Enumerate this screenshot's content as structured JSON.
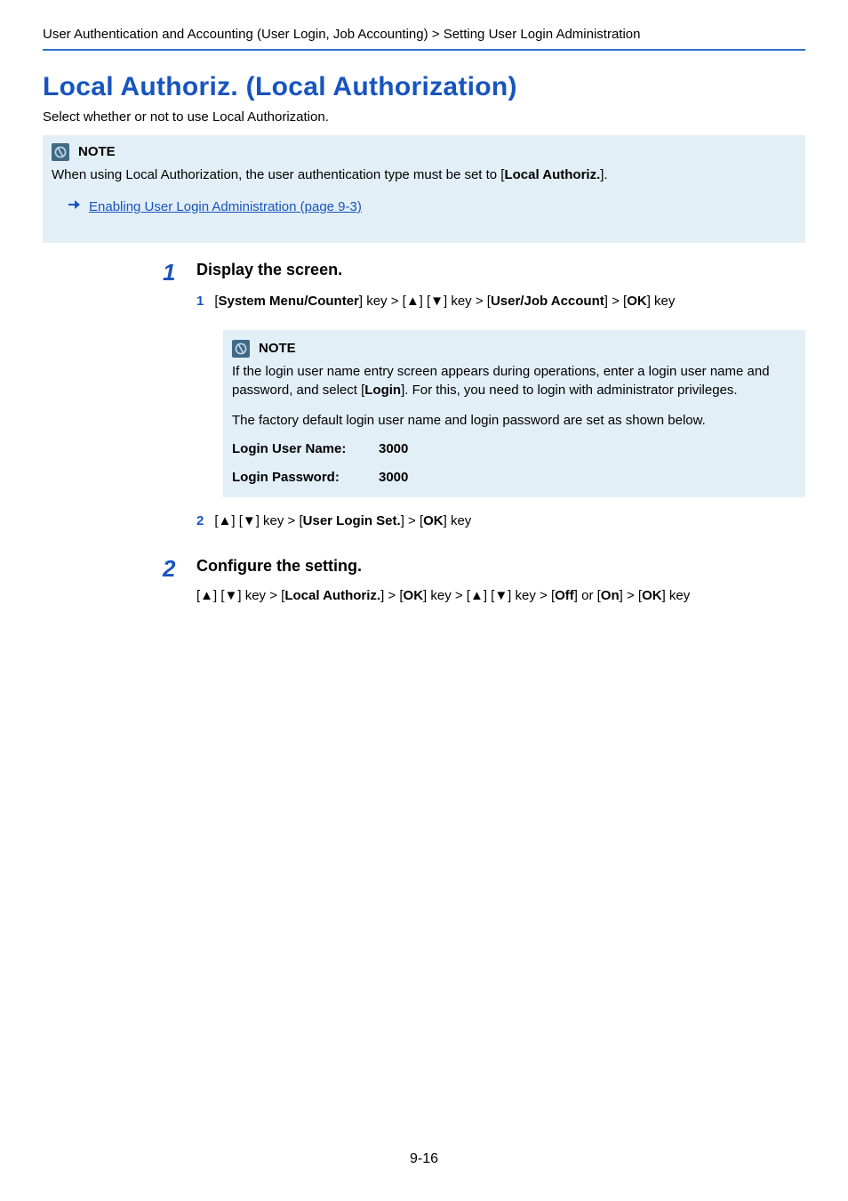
{
  "breadcrumb": "User Authentication and Accounting (User Login, Job Accounting) > Setting User Login Administration",
  "title": "Local Authoriz. (Local Authorization)",
  "intro": "Select whether or not to use Local Authorization.",
  "note1": {
    "label": "NOTE",
    "line1_pre": "When using Local Authorization, the user authentication type must be set to [",
    "line1_bold": "Local Authoriz.",
    "line1_post": "]."
  },
  "link": "Enabling User Login Administration (page 9-3)",
  "step1": {
    "num": "1",
    "title": "Display the screen.",
    "sub1": {
      "num": "1",
      "seg": {
        "a": "[",
        "b": "System Menu/Counter",
        "c": "] key > [▲] [▼] key > [",
        "d": "User/Job Account",
        "e": "] > [",
        "f": "OK",
        "g": "] key"
      }
    },
    "inner_note": {
      "label": "NOTE",
      "p1_a": "If the login user name entry screen appears during operations, enter a login user name and password, and select [",
      "p1_b": "Login",
      "p1_c": "]. For this, you need to login with administrator privileges.",
      "p2": "The factory default login user name and login password are set as shown below.",
      "cred_user_label": "Login User Name:",
      "cred_user_val": "3000",
      "cred_pass_label": "Login Password:",
      "cred_pass_val": "3000"
    },
    "sub2": {
      "num": "2",
      "seg": {
        "a": "[▲] [▼] key > [",
        "b": "User Login Set.",
        "c": "] > [",
        "d": "OK",
        "e": "] key"
      }
    }
  },
  "step2": {
    "num": "2",
    "title": "Configure the setting.",
    "line": {
      "a": "[▲] [▼] key > [",
      "b": "Local Authoriz.",
      "c": "] > [",
      "d": "OK",
      "e": "] key > [▲] [▼] key > [",
      "f": "Off",
      "g": "] or [",
      "h": "On",
      "i": "] > [",
      "j": "OK",
      "k": "] key"
    }
  },
  "page_num": "9-16"
}
